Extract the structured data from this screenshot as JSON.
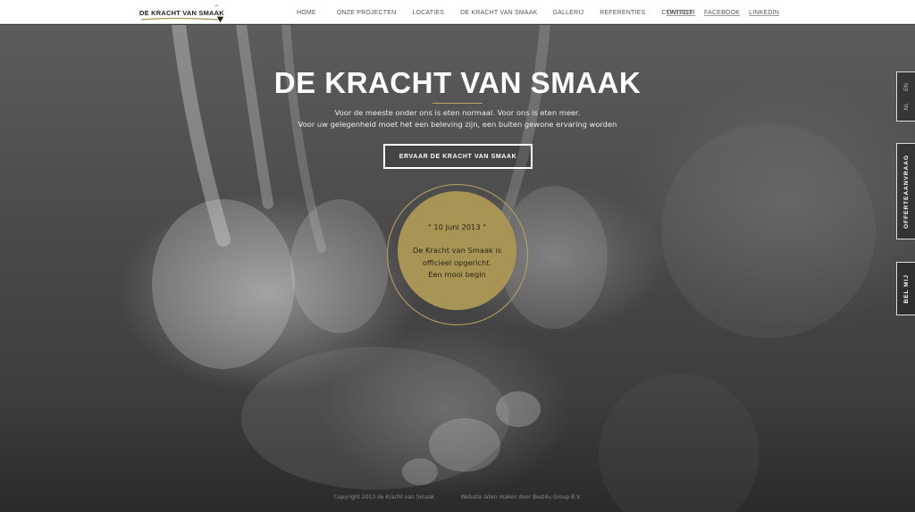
{
  "header": {
    "logo_text": "DE KRACHT VAN SMAAK",
    "nav": [
      "HOME",
      "ONZE PROJECTEN",
      "LOCATIES",
      "DE KRACHT VAN SMAAK",
      "GALLERIJ",
      "REFERENTIES",
      "CONTACT"
    ],
    "social": [
      "TWITTER",
      "FACEBOOK",
      "LINKEDIN"
    ]
  },
  "hero": {
    "title": "DE KRACHT VAN SMAAK",
    "line1": "Voor de meeste onder ons is eten normaal. Voor ons is eten meer.",
    "line2": "Voor uw gelegenheid moet het een beleving zijn, een buiten gewone ervaring worden",
    "cta": "ERVAAR DE KRACHT VAN SMAAK"
  },
  "milestone": {
    "date": "\" 10 Juni 2013 \"",
    "line1": "De Kracht van Smaak is",
    "line2": "officieel opgericht.",
    "line3": "Een mooi begin"
  },
  "side": {
    "lang_en": "EN",
    "lang_nl": "NL",
    "offerte": "OFFERTEAANVRAAG",
    "belmij": "BEL MIJ"
  },
  "footer": {
    "copyright": "Copyright 2013 de Kracht van Smaak",
    "credit": "Website laten maken door Best4u Group B.V."
  },
  "colors": {
    "accent_gold": "#a89555",
    "ring_gold": "#b9a45e",
    "header_bg": "#ffffff"
  }
}
